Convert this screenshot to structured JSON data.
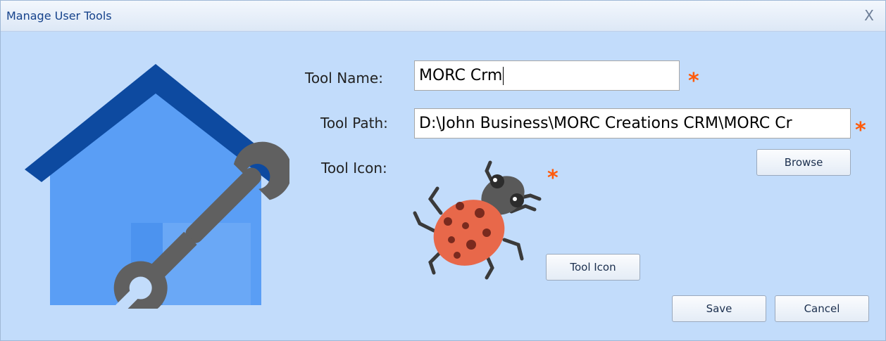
{
  "window": {
    "title": "Manage User Tools",
    "close_glyph": "X"
  },
  "form": {
    "tool_name_label": "Tool Name:",
    "tool_name_value": "MORC Crm",
    "tool_path_label": "Tool Path:",
    "tool_path_value": "D:\\John Business\\MORC Creations CRM\\MORC Cr",
    "tool_icon_label": "Tool Icon:",
    "required_marker": "*"
  },
  "buttons": {
    "browse": "Browse",
    "tool_icon": "Tool Icon",
    "save": "Save",
    "cancel": "Cancel"
  },
  "icons": {
    "house": "house-wrench-icon",
    "tool_icon_preview": "ladybug-icon"
  },
  "colors": {
    "background": "#c2dcfb",
    "required": "#ff5a0a",
    "house_roof": "#0d4aa0",
    "house_body": "#5a9ef5",
    "wrench": "#606060",
    "bug_shell": "#e8684a"
  }
}
